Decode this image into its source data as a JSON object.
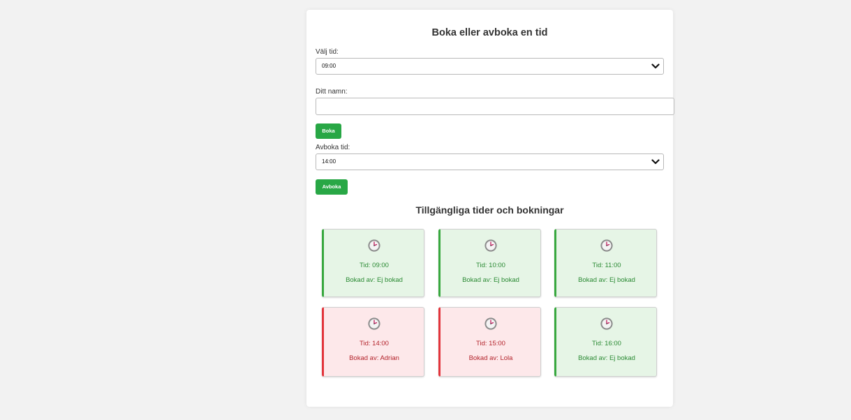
{
  "booking_form": {
    "title": "Boka eller avboka en tid",
    "time_label": "Välj tid:",
    "time_selected": "09:00",
    "name_label": "Ditt namn:",
    "name_value": "",
    "book_button": "Boka",
    "cancel_label": "Avboka tid:",
    "cancel_selected": "14:00",
    "cancel_button": "Avboka"
  },
  "slots_section": {
    "title": "Tillgängliga tider och bokningar",
    "slots": [
      {
        "time": "Tid: 09:00",
        "booked_by": "Bokad av: Ej bokad",
        "status": "free"
      },
      {
        "time": "Tid: 10:00",
        "booked_by": "Bokad av: Ej bokad",
        "status": "free"
      },
      {
        "time": "Tid: 11:00",
        "booked_by": "Bokad av: Ej bokad",
        "status": "free"
      },
      {
        "time": "Tid: 14:00",
        "booked_by": "Bokad av: Adrian",
        "status": "booked"
      },
      {
        "time": "Tid: 15:00",
        "booked_by": "Bokad av: Lola",
        "status": "booked"
      },
      {
        "time": "Tid: 16:00",
        "booked_by": "Bokad av: Ej bokad",
        "status": "free"
      }
    ]
  },
  "colors": {
    "accent_green": "#28a745",
    "free_bg": "#e6f5e6",
    "booked_bg": "#fde8ea",
    "free_border": "#38a83f",
    "booked_border": "#e2353c"
  },
  "icons": {
    "slot_icon": "clock-icon",
    "dropdown_icon": "chevron-down-icon"
  }
}
